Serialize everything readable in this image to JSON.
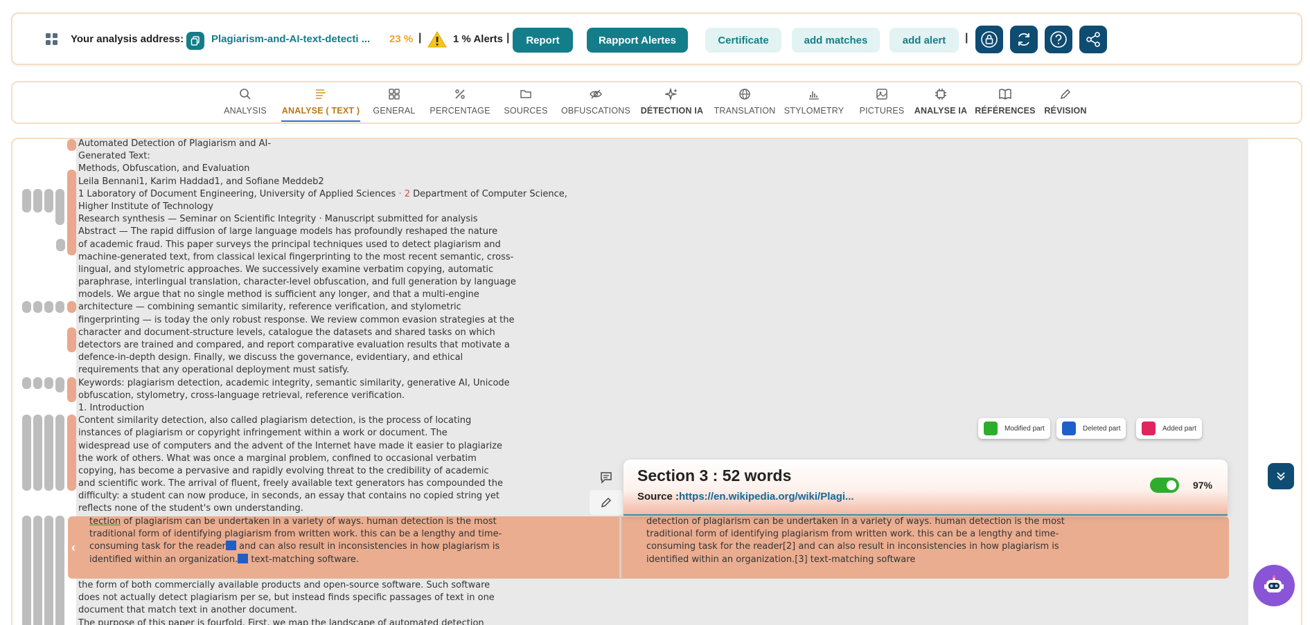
{
  "topbar": {
    "address_label": "Your analysis address:",
    "document_link": "Plagiarism-and-AI-text-detecti ...",
    "percent": "23 %",
    "separator": "|",
    "alerts": "1 % Alerts",
    "buttons": {
      "report": "Report",
      "rapport_alertes": "Rapport Alertes",
      "certificate": "Certificate",
      "add_matches": "add matches",
      "add_alert": "add alert"
    },
    "icons": [
      "grid-icon",
      "copy-icon",
      "warning-icon",
      "lock-icon",
      "refresh-icon",
      "help-icon",
      "share-icon"
    ],
    "colors": {
      "primary": "#137e8a",
      "percent": "#f0a030",
      "icon_button": "#0f4c72"
    }
  },
  "tabs": [
    {
      "label": "ANALYSIS",
      "icon": "search-icon"
    },
    {
      "label": "ANALYSE ( TEXT )",
      "icon": "text-lines-icon",
      "active": true
    },
    {
      "label": "GENERAL",
      "icon": "grid-icon"
    },
    {
      "label": "PERCENTAGE",
      "icon": "percent-icon"
    },
    {
      "label": "SOURCES",
      "icon": "folder-icon"
    },
    {
      "label": "OBFUSCATIONS",
      "icon": "eye-off-icon"
    },
    {
      "label": "DÉTECTION IA",
      "icon": "sparkle-icon"
    },
    {
      "label": "TRANSLATION",
      "icon": "globe-icon"
    },
    {
      "label": "STYLOMETRY",
      "icon": "bar-chart-icon"
    },
    {
      "label": "PICTURES",
      "icon": "image-icon"
    },
    {
      "label": "ANALYSE IA",
      "icon": "chip-icon"
    },
    {
      "label": "RÉFÉRENCES",
      "icon": "book-icon"
    },
    {
      "label": "RÉVISION",
      "icon": "pencil-icon"
    }
  ],
  "document": {
    "lines": [
      "Automated Detection of Plagiarism and AI-",
      "Generated Text:",
      "Methods, Obfuscation, and Evaluation",
      "Leila Bennani1, Karim Haddad1, and Sofiane Meddeb2",
      "1 Laboratory of Document Engineering, University of Applied Sciences",
      "Higher Institute of Technology",
      "Research synthesis — Seminar on Scientific Integrity · Manuscript submitted for analysis",
      "Abstract — The rapid diffusion of large language models has profoundly reshaped the nature",
      "of academic fraud. This paper surveys the principal techniques used to detect plagiarism and",
      "machine-generated text, from classical lexical fingerprinting to the most recent semantic, cross-",
      "lingual, and stylometric approaches. We successively examine verbatim copying, automatic",
      "paraphrase, interlingual translation, character-level obfuscation, and full generation by language",
      "models. We argue that no single method is sufficient any longer, and that a multi-engine",
      "architecture — combining semantic similarity, reference verification, and stylometric",
      "fingerprinting — is today the only robust response. We review common evasion strategies at the",
      "character and document-structure levels, catalogue the datasets and shared tasks on which",
      "detectors are trained and compared, and report comparative evaluation results that motivate a",
      "defence-in-depth design. Finally, we discuss the governance, evidentiary, and ethical",
      "requirements that any operational deployment must satisfy.",
      "Keywords: plagiarism detection, academic integrity, semantic similarity, generative AI, Unicode",
      "obfuscation, stylometry, cross-language retrieval, reference verification.",
      "1. Introduction",
      "Content similarity detection, also called plagiarism detection, is the process of locating",
      "instances of plagiarism or copyright infringement within a work or document. The",
      "widespread use of computers and the advent of the Internet have made it easier to plagiarize",
      "the work of others. What was once a marginal problem, confined to occasional verbatim",
      "copying, has become a pervasive and rapidly evolving threat to the credibility of academic",
      "and scientific work. The arrival of fluent, freely available text generators has compounded the",
      "difficulty: a student can now produce, in seconds, an essay that contains no copied string yet",
      "reflects none of the student's own understanding."
    ],
    "affiliation_marker": "· 2",
    "affiliation_rest": "Department of Computer Science,",
    "after_band_lines": [
      "the form of both commercially available products and open-source software. Such software",
      "does not actually detect plagiarism per se, but instead finds specific passages of text in one",
      "document that match text in another document.",
      "The purpose of this paper is fourfold. First, we map the landscape of automated detection"
    ]
  },
  "highlight": {
    "left": {
      "underlined_word": "tection",
      "line1_rest": " of plagiarism can be undertaken in a variety of ways. human detection is the most",
      "line2": "traditional form of identifying plagiarism from written work. this can be a lengthy and time-",
      "line3_a": "consuming task for the reader",
      "line3_b": " and can also result in inconsistencies in how plagiarism is",
      "line4_a": " identified within an organization.",
      "line4_b": " text-matching software."
    },
    "right": [
      "detection of plagiarism can be undertaken in a variety of ways. human detection is the most",
      " traditional form of identifying plagiarism from written work. this can be a lengthy and time-",
      "consuming task for the reader[2] and can also result in inconsistencies in how plagiarism is",
      " identified within an organization.[3] text-matching software"
    ],
    "color": "#ebad90"
  },
  "section_card": {
    "title": "Section 3 : 52 words",
    "source_label": "Source :",
    "source_link": "https://en.wikipedia.org/wiki/Plagi...",
    "toggle_on": true,
    "percent": "97%"
  },
  "legend": [
    {
      "label": "Modified part",
      "color": "#2cae2c"
    },
    {
      "label": "Deleted part",
      "color": "#1f5fc8"
    },
    {
      "label": "Added part",
      "color": "#e0245e"
    }
  ]
}
